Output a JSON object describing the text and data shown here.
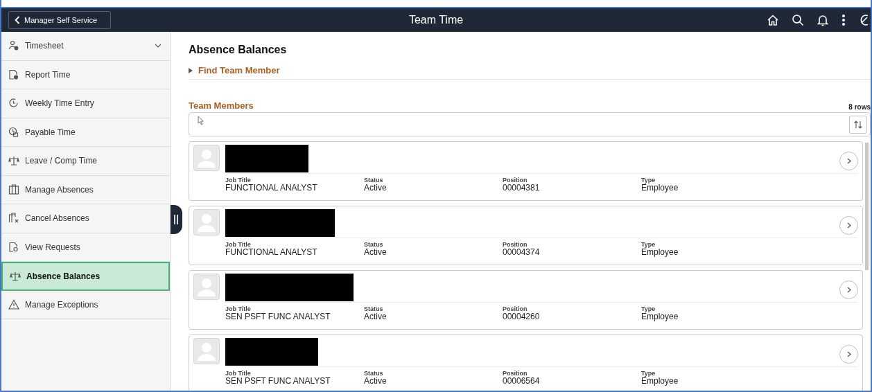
{
  "header": {
    "back_label": "Manager Self Service",
    "title": "Team Time"
  },
  "sidebar": {
    "items": [
      {
        "label": "Timesheet",
        "selected": false,
        "expandable": true
      },
      {
        "label": "Report Time",
        "selected": false
      },
      {
        "label": "Weekly Time Entry",
        "selected": false
      },
      {
        "label": "Payable Time",
        "selected": false
      },
      {
        "label": "Leave / Comp Time",
        "selected": false
      },
      {
        "label": "Manage Absences",
        "selected": false
      },
      {
        "label": "Cancel Absences",
        "selected": false
      },
      {
        "label": "View Requests",
        "selected": false
      },
      {
        "label": "Absence Balances",
        "selected": true
      },
      {
        "label": "Manage Exceptions",
        "selected": false
      }
    ]
  },
  "page_title": "Absence Balances",
  "find_section": {
    "label": "Find Team Member",
    "expanded": false
  },
  "team_members": {
    "title": "Team Members",
    "count": "8 rows",
    "rows": [
      {
        "fields": [
          {
            "label": "Job Title",
            "value": "FUNCTIONAL ANALYST"
          },
          {
            "label": "Status",
            "value": "Active"
          },
          {
            "label": "Position",
            "value": "00004381"
          },
          {
            "label": "Type",
            "value": "Employee"
          }
        ]
      },
      {
        "fields": [
          {
            "label": "Job Title",
            "value": "FUNCTIONAL ANALYST"
          },
          {
            "label": "Status",
            "value": "Active"
          },
          {
            "label": "Position",
            "value": "00004374"
          },
          {
            "label": "Type",
            "value": "Employee"
          }
        ]
      },
      {
        "fields": [
          {
            "label": "Job Title",
            "value": "SEN PSFT FUNC ANALYST"
          },
          {
            "label": "Status",
            "value": "Active"
          },
          {
            "label": "Position",
            "value": "00004260"
          },
          {
            "label": "Type",
            "value": "Employee"
          }
        ]
      },
      {
        "fields": [
          {
            "label": "Job Title",
            "value": "SEN PSFT FUNC ANALYST"
          },
          {
            "label": "Status",
            "value": "Active"
          },
          {
            "label": "Position",
            "value": "00006564"
          },
          {
            "label": "Type",
            "value": "Employee"
          }
        ]
      }
    ]
  }
}
